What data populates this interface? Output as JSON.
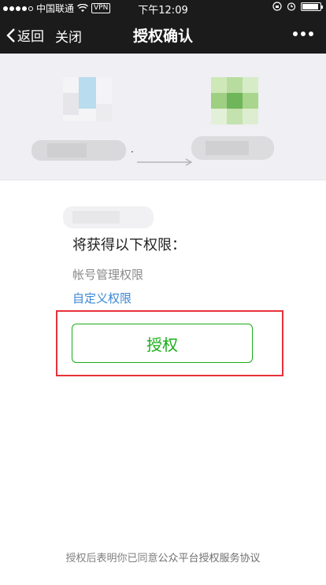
{
  "status_bar": {
    "carrier": "中国联通",
    "vpn": "VPN",
    "time": "下午12:09"
  },
  "nav": {
    "back_label": "返回",
    "close_label": "关闭",
    "title": "授权确认"
  },
  "auth": {
    "permissions_title": "将获得以下权限：",
    "permission_item": "帐号管理权限",
    "custom_link": "自定义权限",
    "authorize_button": "授权"
  },
  "footer": {
    "prefix": "授权后表明你已同意",
    "agreement": "公众平台授权服务协议"
  },
  "colors": {
    "accent_green": "#1aad19",
    "link_blue": "#3b87d6",
    "highlight_red": "#e8313a"
  }
}
